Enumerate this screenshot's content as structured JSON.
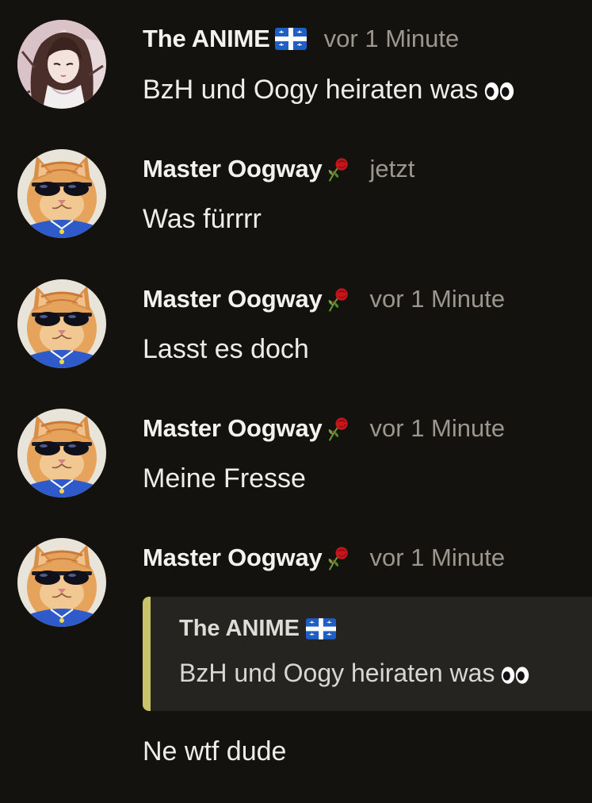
{
  "messages": [
    {
      "author": "The ANIME",
      "author_badge": "quebec-flag-icon",
      "time": "vor 1 Minute",
      "text": "BzH und Oogy heiraten was",
      "text_emoji": "eyes-icon",
      "avatar": "anime-girl-avatar"
    },
    {
      "author": "Master Oogway",
      "author_badge": "wilted-rose-icon",
      "time": "jetzt",
      "text": "Was fürrrr",
      "avatar": "cat-sunglasses-avatar"
    },
    {
      "author": "Master Oogway",
      "author_badge": "wilted-rose-icon",
      "time": "vor 1 Minute",
      "text": "Lasst es doch",
      "avatar": "cat-sunglasses-avatar"
    },
    {
      "author": "Master Oogway",
      "author_badge": "wilted-rose-icon",
      "time": "vor 1 Minute",
      "text": "Meine Fresse",
      "avatar": "cat-sunglasses-avatar"
    },
    {
      "author": "Master Oogway",
      "author_badge": "wilted-rose-icon",
      "time": "vor 1 Minute",
      "quote": {
        "author": "The ANIME",
        "author_badge": "quebec-flag-icon",
        "text": "BzH und Oogy heiraten was",
        "text_emoji": "eyes-icon"
      },
      "text": "Ne wtf dude",
      "avatar": "cat-sunglasses-avatar"
    }
  ],
  "colors": {
    "background": "#13120e",
    "timestamp": "#9a978f",
    "quote_bar": "#c9c46a",
    "quote_background": "#252420"
  }
}
